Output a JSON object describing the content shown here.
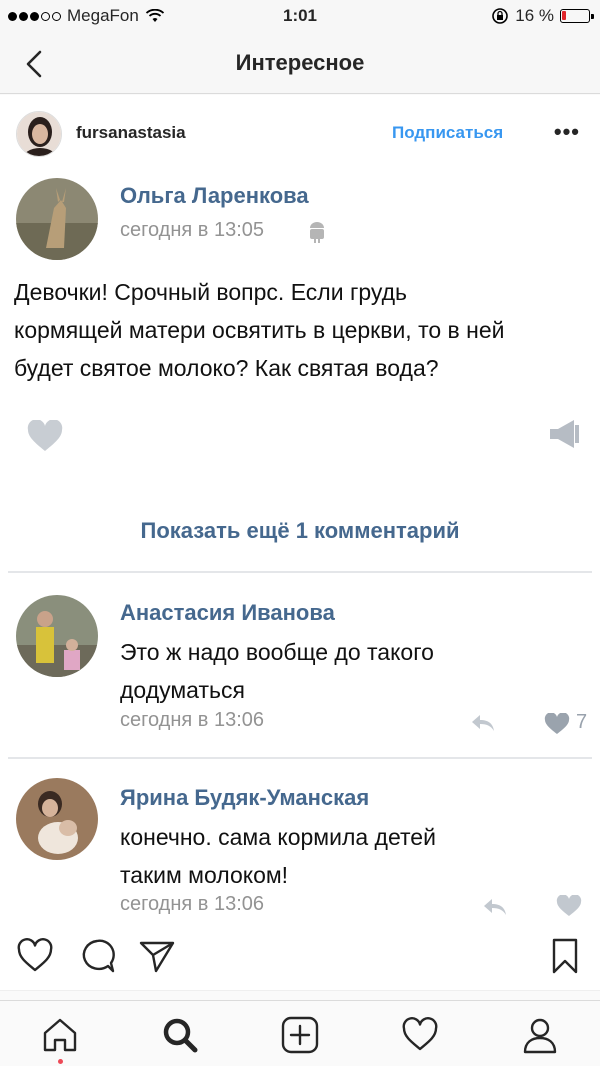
{
  "status_bar": {
    "carrier": "MegaFon",
    "time": "1:01",
    "battery_percent": "16 %",
    "battery_level": 0.16,
    "battery_color": "#e0262b"
  },
  "nav": {
    "title": "Интересное",
    "back_icon": "chevron-left-icon"
  },
  "post": {
    "username": "fursanastasia",
    "follow_label": "Подписаться",
    "more_label": "•••",
    "accent_color": "#3897f0"
  },
  "photo": {
    "comment_1": {
      "author": "Ольга Ларенкова",
      "time": "сегодня в 13:05",
      "text": [
        "Девочки! Срочный вопрс. Если грудь",
        "кормящей матери освятить в церкви, то в ней",
        "будет святое молоко? Как святая вода?"
      ]
    },
    "show_more_label": "Показать ещё 1 комментарий",
    "comment_2": {
      "author": "Анастасия Иванова",
      "text": [
        "Это ж надо вообще до такого",
        "додуматься"
      ],
      "time": "сегодня в 13:06",
      "likes": "7"
    },
    "comment_3": {
      "author": "Ярина Будяк-Уманская",
      "text": [
        "конечно. сама кормила детей",
        "таким молоком!"
      ],
      "time": "сегодня в 13:06"
    },
    "vk_link_color": "#45688e"
  },
  "actions": {
    "like_icon": "heart-icon",
    "comment_icon": "comment-icon",
    "share_icon": "paper-plane-icon",
    "save_icon": "bookmark-icon"
  },
  "tabs": [
    "home-icon",
    "search-icon",
    "add-icon",
    "activity-icon",
    "profile-icon"
  ]
}
